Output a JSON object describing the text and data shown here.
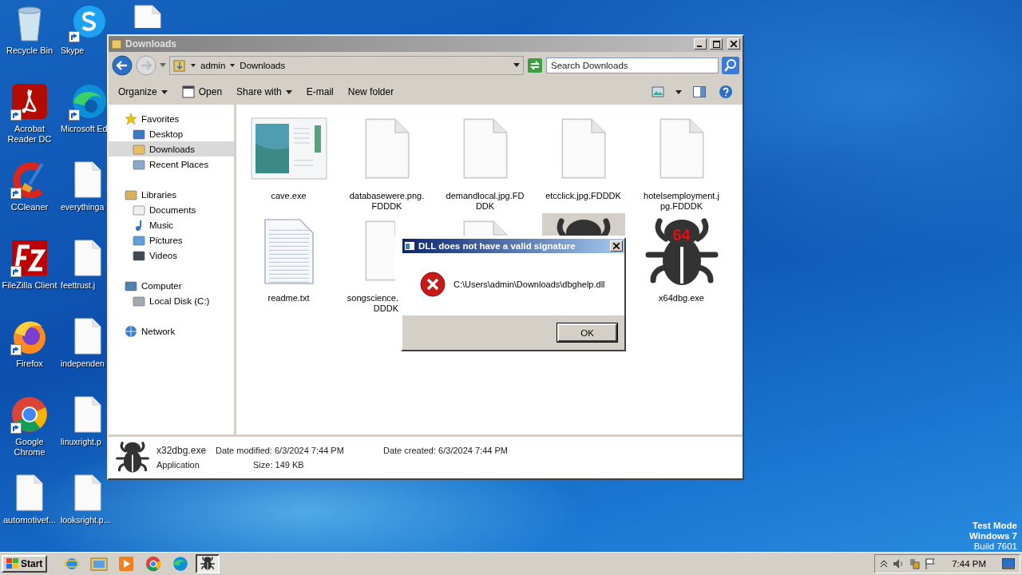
{
  "desktop": {
    "columns": [
      [
        {
          "label": "Recycle Bin",
          "kind": "recycle",
          "shortcut": false
        },
        {
          "label": "Acrobat Reader DC",
          "kind": "acrobat",
          "shortcut": true
        },
        {
          "label": "CCleaner",
          "kind": "ccleaner",
          "shortcut": true
        },
        {
          "label": "FileZilla Client",
          "kind": "filezilla",
          "shortcut": true
        },
        {
          "label": "Firefox",
          "kind": "firefox",
          "shortcut": true
        },
        {
          "label": "Google Chrome",
          "kind": "chrome",
          "shortcut": true
        },
        {
          "label": "automotivef...",
          "kind": "file",
          "shortcut": false
        }
      ],
      [
        {
          "label": "Skype",
          "kind": "skype",
          "shortcut": true
        },
        {
          "label": "Microsoft Ed",
          "kind": "edge",
          "shortcut": true
        },
        {
          "label": "everythinga",
          "kind": "file",
          "shortcut": false
        },
        {
          "label": "feettrust.j",
          "kind": "file",
          "shortcut": false
        },
        {
          "label": "independen",
          "kind": "file",
          "shortcut": false
        },
        {
          "label": "linuxright.p",
          "kind": "file",
          "shortcut": false
        },
        {
          "label": "looksright.p...",
          "kind": "file",
          "shortcut": false
        }
      ],
      [
        {
          "kind": "file",
          "shortcut": false
        }
      ]
    ]
  },
  "explorer": {
    "title": "Downloads",
    "breadcrumb": [
      "admin",
      "Downloads"
    ],
    "search": {
      "placeholder": "Search Downloads"
    },
    "toolbar": [
      {
        "label": "Organize",
        "kind": "menu"
      },
      {
        "label": "Open",
        "kind": "open"
      },
      {
        "label": "Share with",
        "kind": "menu"
      },
      {
        "label": "E-mail",
        "kind": "plain"
      },
      {
        "label": "New folder",
        "kind": "plain"
      }
    ],
    "nav": [
      {
        "label": "Favorites",
        "kind": "star",
        "selected": false,
        "children": [
          {
            "label": "Desktop",
            "kind": "desktop",
            "selected": false
          },
          {
            "label": "Downloads",
            "kind": "downloads",
            "selected": true
          },
          {
            "label": "Recent Places",
            "kind": "recent",
            "selected": false
          }
        ]
      },
      {
        "label": "Libraries",
        "kind": "library",
        "selected": false,
        "children": [
          {
            "label": "Documents",
            "kind": "documents",
            "selected": false
          },
          {
            "label": "Music",
            "kind": "music",
            "selected": false
          },
          {
            "label": "Pictures",
            "kind": "pictures",
            "selected": false
          },
          {
            "label": "Videos",
            "kind": "videos",
            "selected": false
          }
        ]
      },
      {
        "label": "Computer",
        "kind": "computer",
        "selected": false,
        "children": [
          {
            "label": "Local Disk (C:)",
            "kind": "disk",
            "selected": false
          }
        ]
      },
      {
        "label": "Network",
        "kind": "network",
        "selected": false
      }
    ],
    "files": [
      {
        "kind": "app",
        "label_lines": [
          "cave.exe"
        ],
        "selected": false
      },
      {
        "kind": "blank",
        "label_lines": [
          "databasewere.png.",
          "FDDDK"
        ],
        "selected": false
      },
      {
        "kind": "blank",
        "label_lines": [
          "demandlocal.jpg.FD",
          "DDK"
        ],
        "selected": false
      },
      {
        "kind": "blank",
        "label_lines": [
          "etcclick.jpg.FDDDK"
        ],
        "selected": false
      },
      {
        "kind": "blank",
        "label_lines": [
          "hotelsemployment.j",
          "pg.FDDDK"
        ],
        "selected": false
      },
      {
        "kind": "text",
        "label_lines": [
          "readme.txt"
        ],
        "selected": false
      },
      {
        "kind": "blank",
        "label_lines": [
          "songscience.",
          "DDDK"
        ],
        "cut_right": true,
        "selected": false
      },
      {
        "kind": "blank",
        "cut_bottom": true,
        "selected": false
      },
      {
        "kind": "bug",
        "cut_bottom": true,
        "selected": true
      },
      {
        "kind": "bug",
        "badge": "64",
        "label_lines": [
          "x64dbg.exe"
        ],
        "selected": false
      }
    ],
    "details": {
      "name": "x32dbg.exe",
      "type": "Application",
      "fields": [
        {
          "label": "Date modified:",
          "value": "6/3/2024 7:44 PM"
        },
        {
          "label": "Date created:",
          "value": "6/3/2024 7:44 PM"
        },
        {
          "label": "Size:",
          "value": "149 KB"
        }
      ]
    }
  },
  "dialog": {
    "title": "DLL does not have a valid signature",
    "message": "C:\\Users\\admin\\Downloads\\dbghelp.dll",
    "button": "OK"
  },
  "system_notice": [
    "Test Mode",
    "Windows 7",
    "Build 7601"
  ],
  "taskbar": {
    "start": "Start",
    "apps": [
      {
        "kind": "ie",
        "active": false
      },
      {
        "kind": "explorer",
        "active": false
      },
      {
        "kind": "media",
        "active": false
      },
      {
        "kind": "chrome",
        "active": false
      },
      {
        "kind": "edge",
        "active": false
      },
      {
        "kind": "bug",
        "active": true
      }
    ],
    "clock": "7:44 PM"
  }
}
